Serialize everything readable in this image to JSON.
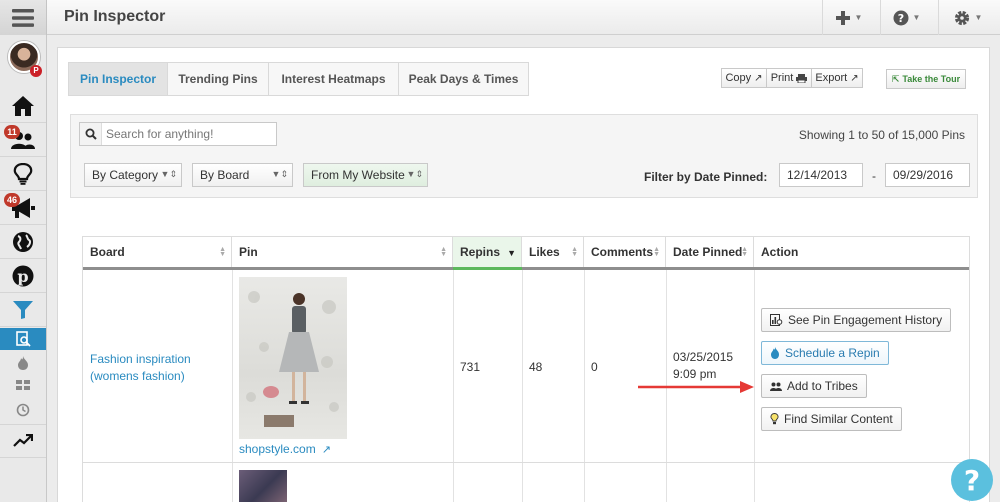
{
  "app": {
    "title": "Pin Inspector"
  },
  "sidebar": {
    "avatar_badge": "P",
    "badges": {
      "tribes": "11",
      "promote": "46"
    }
  },
  "tabs": [
    {
      "label": "Pin Inspector",
      "active": true
    },
    {
      "label": "Trending Pins"
    },
    {
      "label": "Interest Heatmaps"
    },
    {
      "label": "Peak Days & Times"
    }
  ],
  "toolbar": {
    "copy": "Copy",
    "print": "Print",
    "export": "Export",
    "tour": "Take the Tour"
  },
  "filters": {
    "search_placeholder": "Search for anything!",
    "showing": "Showing 1 to 50 of 15,000 Pins",
    "category": "By Category",
    "board": "By Board",
    "source": "From My Website",
    "date_label": "Filter by Date Pinned:",
    "date_from": "12/14/2013",
    "date_sep": "-",
    "date_to": "09/29/2016"
  },
  "table": {
    "columns": [
      "Board",
      "Pin",
      "Repins",
      "Likes",
      "Comments",
      "Date Pinned",
      "Action"
    ],
    "rows": [
      {
        "board": "Fashion inspiration (womens fashion)",
        "pin_source": "shopstyle.com",
        "repins": "731",
        "likes": "48",
        "comments": "0",
        "date": "03/25/2015",
        "time": "9:09 pm"
      }
    ],
    "actions": [
      "See Pin Engagement History",
      "Schedule a Repin",
      "Add to Tribes",
      "Find Similar Content"
    ]
  },
  "help": "?",
  "colors": {
    "accent": "#2a8bc0",
    "arrow": "#e53935",
    "sorted": "#5cb85c",
    "help": "#5bc0de"
  }
}
